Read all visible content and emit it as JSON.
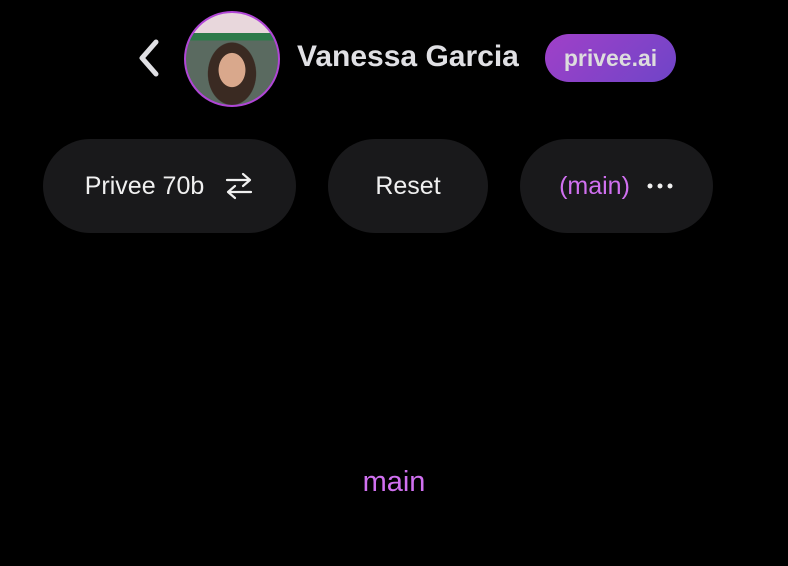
{
  "header": {
    "name": "Vanessa Garcia",
    "badge": "privee.ai",
    "back_icon": "chevron-left-icon"
  },
  "toolbar": {
    "model_label": "Privee 70b",
    "model_icon": "swap-arrows-icon",
    "reset_label": "Reset",
    "branch_label": "(main)",
    "more_icon": "ellipsis-icon"
  },
  "main": {
    "branch_name": "main"
  },
  "colors": {
    "accent": "#d070f0",
    "pill_bg": "#19191b",
    "badge_start": "#a040c8",
    "badge_end": "#6f45c8"
  }
}
